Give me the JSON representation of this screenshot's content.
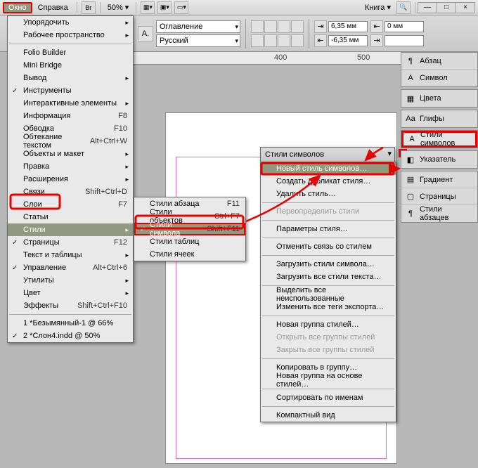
{
  "menubar": {
    "window": "Окно",
    "help": "Справка",
    "br": "Br",
    "zoom": "50%",
    "book": "Книга"
  },
  "win": {
    "min": "—",
    "max": "□",
    "close": "×"
  },
  "ctrl": {
    "para_dd": "Оглавление страницы",
    "lang_dd": "Русский",
    "indent1": "6,35 мм",
    "indent2": "-6,35 мм",
    "indent3": "0 мм"
  },
  "ruler": {
    "t1": "400",
    "t2": "500"
  },
  "menu_window": [
    {
      "l": "Упорядочить",
      "sub": true
    },
    {
      "l": "Рабочее пространство",
      "sub": true
    },
    {
      "sep": true
    },
    {
      "l": "Folio Builder"
    },
    {
      "l": "Mini Bridge"
    },
    {
      "l": "Вывод",
      "sub": true
    },
    {
      "l": "Инструменты",
      "chk": true
    },
    {
      "l": "Интерактивные элементы",
      "sub": true
    },
    {
      "l": "Информация",
      "sc": "F8"
    },
    {
      "l": "Обводка",
      "sc": "F10"
    },
    {
      "l": "Обтекание текстом",
      "sc": "Alt+Ctrl+W"
    },
    {
      "l": "Объекты и макет",
      "sub": true
    },
    {
      "l": "Правка",
      "sub": true
    },
    {
      "l": "Расширения",
      "sub": true
    },
    {
      "l": "Связи",
      "sc": "Shift+Ctrl+D"
    },
    {
      "l": "Слои",
      "sc": "F7"
    },
    {
      "l": "Статьи"
    },
    {
      "l": "Стили",
      "sub": true,
      "hi": true
    },
    {
      "l": "Страницы",
      "sc": "F12",
      "chk": true
    },
    {
      "l": "Текст и таблицы",
      "sub": true
    },
    {
      "l": "Управление",
      "sc": "Alt+Ctrl+6",
      "chk": true
    },
    {
      "l": "Утилиты",
      "sub": true
    },
    {
      "l": "Цвет",
      "sub": true
    },
    {
      "l": "Эффекты",
      "sc": "Shift+Ctrl+F10"
    },
    {
      "sep": true
    },
    {
      "l": "1 *Безымянный-1 @ 66%"
    },
    {
      "l": "2 *Слон4.indd @ 50%",
      "chk": true
    }
  ],
  "menu_styles": [
    {
      "l": "Стили абзаца",
      "sc": "F11"
    },
    {
      "l": "Стили объектов",
      "sc": "Ctrl+F7"
    },
    {
      "l": "Стили символа",
      "sc": "Shift+F11",
      "chk": true,
      "hi": true
    },
    {
      "l": "Стили таблиц"
    },
    {
      "l": "Стили ячеек"
    }
  ],
  "panel_title": "Стили символов",
  "menu_flyout": [
    {
      "l": "Новый стиль символов…",
      "hi": true
    },
    {
      "l": "Создать дубликат стиля…"
    },
    {
      "l": "Удалить стиль…"
    },
    {
      "sep": true
    },
    {
      "l": "Переопределить стили",
      "dis": true
    },
    {
      "sep": true
    },
    {
      "l": "Параметры стиля…"
    },
    {
      "sep": true
    },
    {
      "l": "Отменить связь со стилем"
    },
    {
      "sep": true
    },
    {
      "l": "Загрузить стили символа…"
    },
    {
      "l": "Загрузить все стили текста…"
    },
    {
      "sep": true
    },
    {
      "l": "Выделить все неиспользованные"
    },
    {
      "l": "Изменить все теги экспорта…"
    },
    {
      "sep": true
    },
    {
      "l": "Новая группа стилей…"
    },
    {
      "l": "Открыть все группы стилей",
      "dis": true
    },
    {
      "l": "Закрыть все группы стилей",
      "dis": true
    },
    {
      "sep": true
    },
    {
      "l": "Копировать в группу…"
    },
    {
      "l": "Новая группа на основе стилей…"
    },
    {
      "sep": true
    },
    {
      "l": "Сортировать по именам"
    },
    {
      "sep": true
    },
    {
      "l": "Компактный вид"
    }
  ],
  "rpanels": [
    [
      {
        "ic": "¶",
        "l": "Абзац"
      },
      {
        "ic": "A",
        "l": "Символ"
      }
    ],
    [
      {
        "ic": "▦",
        "l": "Цвета"
      }
    ],
    [
      {
        "ic": "Aa",
        "l": "Глифы"
      }
    ],
    [
      {
        "ic": "A",
        "l": "Стили символов",
        "hi": true
      }
    ],
    [
      {
        "ic": "◧",
        "l": "Указатель"
      }
    ],
    [
      {
        "ic": "▤",
        "l": "Градиент"
      },
      {
        "ic": "▢",
        "l": "Страницы"
      },
      {
        "ic": "¶",
        "l": "Стили абзацев"
      }
    ]
  ]
}
